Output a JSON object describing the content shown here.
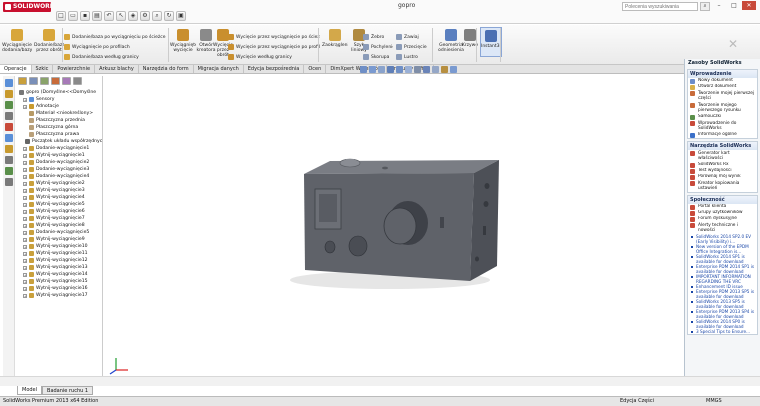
{
  "app": {
    "logo_text": "SOLIDWORKS",
    "doc_title": "gopro",
    "search_placeholder": "Polecenia wyszukiwania",
    "search_icon": "search-icon",
    "window_controls": {
      "minimize": "–",
      "maximize": "□",
      "close": "✕"
    }
  },
  "toolbar_top": [
    "new-icon",
    "open-icon",
    "save-icon",
    "print-icon",
    "undo-icon",
    "select-icon",
    "rebuild-icon",
    "options-icon",
    "zoom-icon",
    "rotate-icon",
    "view-icon"
  ],
  "ribbon": {
    "big": [
      {
        "label": "Wyciągnięcie dodania/bazy",
        "icon": "extrude-boss-icon",
        "color": "#d8a63a"
      },
      {
        "label": "Dodanie/baza przez obrót",
        "icon": "revolve-boss-icon",
        "color": "#d8a63a"
      },
      {
        "label": "Wyciągnięte wycięcie",
        "icon": "extrude-cut-icon",
        "color": "#c98f2e"
      },
      {
        "label": "Otwór kreatora",
        "icon": "hole-wizard-icon",
        "color": "#8a8a8a"
      },
      {
        "label": "Wycięcie przez obrót",
        "icon": "revolve-cut-icon",
        "color": "#c98f2e"
      },
      {
        "label": "Zaokrąglenie",
        "icon": "fillet-icon",
        "color": "#d3a84a"
      },
      {
        "label": "Szyk liniowy",
        "icon": "linear-pattern-icon",
        "color": "#b08a40"
      },
      {
        "label": "Geometria odniesienia",
        "icon": "reference-geometry-icon",
        "color": "#5a7fbf"
      },
      {
        "label": "Krzywe",
        "icon": "curves-icon",
        "color": "#7f7f7f"
      },
      {
        "label": "Instant3D",
        "icon": "instant3d-icon",
        "color": "#4a6fb3"
      }
    ],
    "rows_a": [
      "Dodanie/baza po wyciągnięciu po ścieżce",
      "Wyciągnięcie po profilach",
      "Dodanie/baza według granicy"
    ],
    "rows_b": [
      "Wycięcie przez wyciągnięcie po ścieżce",
      "Wycięcie przez wyciągnięcie po profilach",
      "Wycięcie według granicy"
    ],
    "rows_c": [
      "Żebro",
      "Pochylenie",
      "Skorupa"
    ],
    "rows_d": [
      "Zawiaj",
      "Przecięcie",
      "Lustro"
    ]
  },
  "command_tabs": [
    "Operacje",
    "Szkic",
    "Powierzchnie",
    "Arkusz blachy",
    "Narzędzia do form",
    "Migracja danych",
    "Edycja bezpośrednia",
    "Ocen",
    "DimXpert Wymiarów",
    "Produkty Office"
  ],
  "active_command_tab": 0,
  "feature_tree": [
    {
      "label": "gopro  (Domyślne<<Domyślne",
      "icon": "part-icon",
      "color": "#777",
      "plus": false
    },
    {
      "label": "Sensory",
      "icon": "sensor-icon",
      "color": "#5a8fd8",
      "plus": true
    },
    {
      "label": "Adnotacje",
      "icon": "annotation-icon",
      "color": "#c89a2e",
      "plus": true
    },
    {
      "label": "Materiał <nieokreślony>",
      "icon": "material-icon",
      "color": "#b79a66",
      "plus": false
    },
    {
      "label": "Płaszczyzna przednia",
      "icon": "plane-icon",
      "color": "#b9a07a",
      "plus": false
    },
    {
      "label": "Płaszczyzna górna",
      "icon": "plane-icon",
      "color": "#b9a07a",
      "plus": false
    },
    {
      "label": "Płaszczyzna prawa",
      "icon": "plane-icon",
      "color": "#b9a07a",
      "plus": false
    },
    {
      "label": "Początek układu współrzędnych",
      "icon": "origin-icon",
      "color": "#666",
      "plus": false
    },
    {
      "label": "Dodanie-wyciągnięcie1",
      "icon": "feature-icon",
      "color": "#c9a03c",
      "plus": true
    },
    {
      "label": "Wytnij-wyciągnięcie1",
      "icon": "feature-icon",
      "color": "#c9a03c",
      "plus": true
    },
    {
      "label": "Dodanie-wyciągnięcie2",
      "icon": "feature-icon",
      "color": "#c9a03c",
      "plus": true
    },
    {
      "label": "Dodanie-wyciągnięcie3",
      "icon": "feature-icon",
      "color": "#c9a03c",
      "plus": true
    },
    {
      "label": "Dodanie-wyciągnięcie4",
      "icon": "feature-icon",
      "color": "#c9a03c",
      "plus": true
    },
    {
      "label": "Wytnij-wyciągnięcie2",
      "icon": "feature-icon",
      "color": "#c9a03c",
      "plus": true
    },
    {
      "label": "Wytnij-wyciągnięcie3",
      "icon": "feature-icon",
      "color": "#c9a03c",
      "plus": true
    },
    {
      "label": "Wytnij-wyciągnięcie4",
      "icon": "feature-icon",
      "color": "#c9a03c",
      "plus": true
    },
    {
      "label": "Wytnij-wyciągnięcie5",
      "icon": "feature-icon",
      "color": "#c9a03c",
      "plus": true
    },
    {
      "label": "Wytnij-wyciągnięcie6",
      "icon": "feature-icon",
      "color": "#c9a03c",
      "plus": true
    },
    {
      "label": "Wytnij-wyciągnięcie7",
      "icon": "feature-icon",
      "color": "#c9a03c",
      "plus": true
    },
    {
      "label": "Wytnij-wyciągnięcie8",
      "icon": "feature-icon",
      "color": "#c9a03c",
      "plus": true
    },
    {
      "label": "Dodanie-wyciągnięcie5",
      "icon": "feature-icon",
      "color": "#c9a03c",
      "plus": true
    },
    {
      "label": "Wytnij-wyciągnięcie9",
      "icon": "feature-icon",
      "color": "#c9a03c",
      "plus": true
    },
    {
      "label": "Wytnij-wyciągnięcie10",
      "icon": "feature-icon",
      "color": "#c9a03c",
      "plus": true
    },
    {
      "label": "Wytnij-wyciągnięcie11",
      "icon": "feature-icon",
      "color": "#c9a03c",
      "plus": true
    },
    {
      "label": "Wytnij-wyciągnięcie12",
      "icon": "feature-icon",
      "color": "#c9a03c",
      "plus": true
    },
    {
      "label": "Wytnij-wyciągnięcie13",
      "icon": "feature-icon",
      "color": "#c9a03c",
      "plus": true
    },
    {
      "label": "Wytnij-wyciągnięcie14",
      "icon": "feature-icon",
      "color": "#c9a03c",
      "plus": true
    },
    {
      "label": "Wytnij-wyciągnięcie15",
      "icon": "feature-icon",
      "color": "#c9a03c",
      "plus": true
    },
    {
      "label": "Wytnij-wyciągnięcie16",
      "icon": "feature-icon",
      "color": "#c9a03c",
      "plus": true
    },
    {
      "label": "Wytnij-wyciągnięcie17",
      "icon": "feature-icon",
      "color": "#c9a03c",
      "plus": true
    }
  ],
  "task_pane": {
    "title": "Zasoby SolidWorks",
    "sections": [
      {
        "header": "Wprowadzenie",
        "items": [
          {
            "label": "Nowy dokument",
            "icon": "new-document-icon",
            "color": "#6b8cc9"
          },
          {
            "label": "Otwórz dokument",
            "icon": "open-document-icon",
            "color": "#d8b04a"
          },
          {
            "label": "Tworzenie mojej pierwszej części",
            "icon": "tutorial-icon",
            "color": "#c86b3a"
          },
          {
            "label": "Tworzenie mojego pierwszego rysunku",
            "icon": "tutorial-icon",
            "color": "#c86b3a"
          },
          {
            "label": "Samouczki",
            "icon": "tutorials-icon",
            "color": "#5a8f4a"
          },
          {
            "label": "Wprowadzenie do SolidWorks",
            "icon": "intro-icon",
            "color": "#c84a3a"
          },
          {
            "label": "Informacje ogólne",
            "icon": "info-icon",
            "color": "#3a6fc8"
          }
        ]
      },
      {
        "header": "Narzędzia SolidWorks",
        "items": [
          {
            "label": "Generator kart właściwości",
            "icon": "property-tab-icon",
            "color": "#c84a3a"
          },
          {
            "label": "SolidWorks Rx",
            "icon": "rx-icon",
            "color": "#c84a3a"
          },
          {
            "label": "Test wydajności",
            "icon": "performance-icon",
            "color": "#c84a3a"
          },
          {
            "label": "Porównaj mój wynik",
            "icon": "compare-icon",
            "color": "#c84a3a"
          },
          {
            "label": "Kreator kopiowania ustawień",
            "icon": "copy-settings-icon",
            "color": "#c84a3a"
          }
        ]
      },
      {
        "header": "Społeczność",
        "items": [
          {
            "label": "Portal klienta",
            "icon": "portal-icon",
            "color": "#c84a3a"
          },
          {
            "label": "Grupy użytkowników",
            "icon": "users-icon",
            "color": "#c84a3a"
          },
          {
            "label": "Forum dyskusyjne",
            "icon": "forum-icon",
            "color": "#c84a3a"
          },
          {
            "label": "Alerty techniczne i nowości",
            "icon": "alerts-icon",
            "color": "#c84a3a"
          }
        ]
      }
    ],
    "news": [
      "SolidWorks 2014 SP2.0 EV (Early Visibility) i...",
      "New version of the EPDM Office Integration is...",
      "SolidWorks 2014 SP1 is available for download",
      "Enterprise PDM 2014 SP1 is available for download",
      "IMPORTANT INFORMATION REGARDING THE VRC",
      "Enhancement ID issue",
      "Enterprise PDM 2013 SP5 is available for download",
      "SolidWorks 2013 SP5 is available for download",
      "Enterprise PDM 2013 SP4 is available for download",
      "SolidWorks 2014 SP0 is available for download",
      "3 Special Tips to Ensure..."
    ]
  },
  "model_tabs": [
    "Model",
    "Badanie ruchu 1"
  ],
  "active_model_tab": 0,
  "statusbar": {
    "left": "SolidWorks Premium 2013 x64 Edition",
    "mid": "Edycja Części",
    "right": "MMGS"
  }
}
